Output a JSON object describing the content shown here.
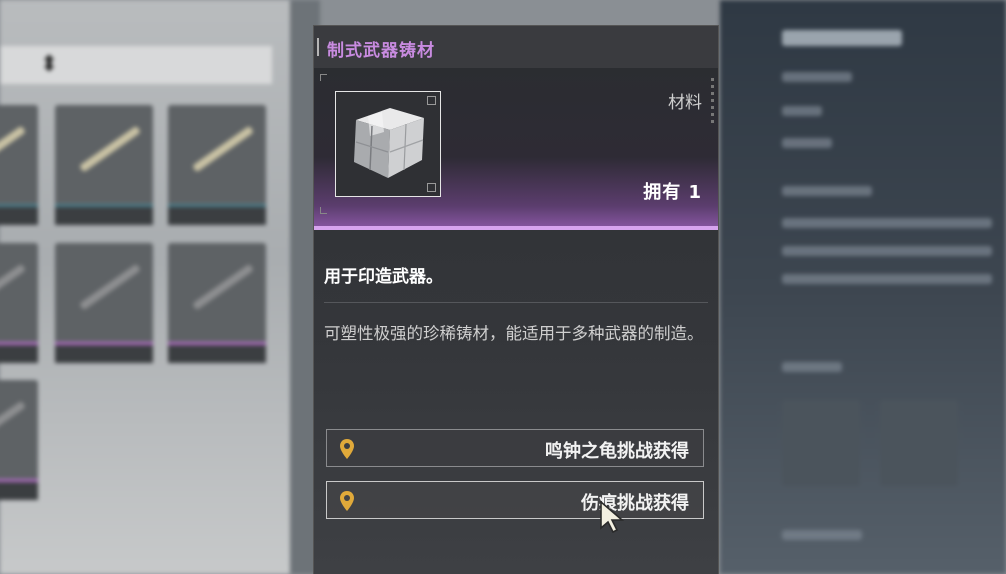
{
  "item": {
    "name": "制式武器铸材",
    "type": "材料",
    "owned": "拥有 1",
    "short_desc": "用于印造武器。",
    "long_desc": "可塑性极强的珍稀铸材，能适用于多种武器的制造。",
    "rarity_color": "#c88be0"
  },
  "sources": [
    {
      "label": "鸣钟之龟挑战获得",
      "icon": "location-pin-icon"
    },
    {
      "label": "伤痕挑战获得",
      "icon": "location-pin-icon"
    }
  ],
  "colors": {
    "accent": "#c88be0",
    "rarity_bar": "#d7a4ef",
    "pin": "#e0a93a"
  }
}
